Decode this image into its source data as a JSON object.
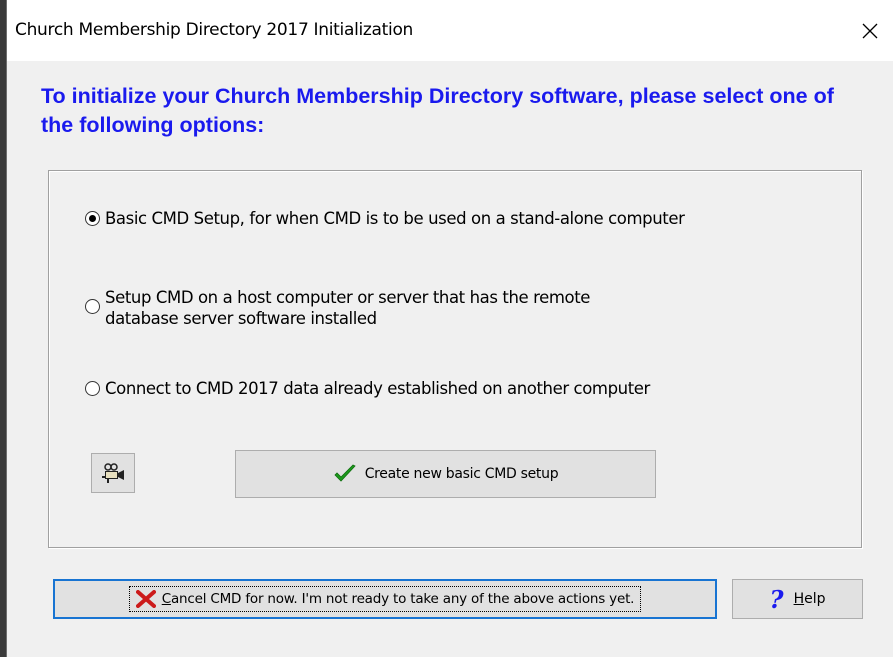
{
  "window": {
    "title": "Church Membership Directory 2017 Initialization",
    "close_icon": "close-icon"
  },
  "heading": "To initialize your Church Membership Directory software, please select one of the following options:",
  "options": [
    {
      "label": "Basic CMD Setup, for when CMD is to be used on a stand-alone computer",
      "checked": true
    },
    {
      "label_line1": "Setup CMD on a host computer or server that has the remote",
      "label_line2": "database server software installed",
      "checked": false
    },
    {
      "label": "Connect to CMD 2017 data already established on another computer",
      "checked": false
    }
  ],
  "buttons": {
    "camera_icon": "video-camera-icon",
    "create": "Create new basic CMD setup",
    "create_icon": "checkmark-icon",
    "cancel_underline": "C",
    "cancel_rest": "ancel CMD for now. I'm not ready to take any of the above actions yet.",
    "cancel_icon": "red-x-icon",
    "help_underline": "H",
    "help_rest": "elp",
    "help_icon": "question-mark-icon"
  },
  "colors": {
    "heading": "#1a1aee",
    "checkmark": "#1c9a1c",
    "cancel_x": "#cc1a1a",
    "focus_border": "#1874d2"
  }
}
